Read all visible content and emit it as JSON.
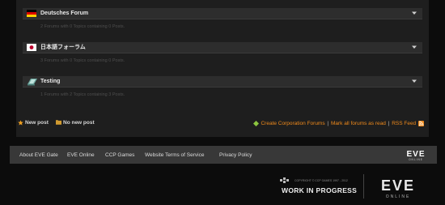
{
  "forums": [
    {
      "title": "Deutsches Forum",
      "stats": "2 Forums with 0 Topics containing 0 Posts.",
      "flag_icon": "germany-flag-icon"
    },
    {
      "title": "日本語フォーラム",
      "stats": "3 Forums with 0 Topics containing 0 Posts.",
      "flag_icon": "japan-flag-icon"
    },
    {
      "title": "Testing",
      "stats": "1 Forums with 2 Topics containing 3 Posts.",
      "flag_icon": "testing-icon"
    }
  ],
  "legend": {
    "new_post": "New post",
    "no_new_post": "No new post"
  },
  "actions": {
    "create_corp": "Create Corporation Forums",
    "sep1": "|",
    "mark_all": "Mark all forums as read",
    "sep2": "|",
    "rss": "RSS Feed"
  },
  "footer": {
    "links": [
      "About EVE Gate",
      "EVE Online",
      "CCP Games",
      "Website Terms of Service",
      "Privacy Policy"
    ],
    "logo_text": "EVE",
    "logo_subtext": "ONLINE"
  },
  "bottom": {
    "copyright": "COPYRIGHT © CCP GAMES 1997 - 2012",
    "wip": "WORK IN PROGRESS",
    "eve_logo": "EVE",
    "eve_sub": "ONLINE"
  },
  "colors": {
    "accent_orange": "#f08a1b",
    "panel_bg": "#1e1e1e",
    "header_bg": "#2d2d2d",
    "footer_bg": "#383838"
  }
}
